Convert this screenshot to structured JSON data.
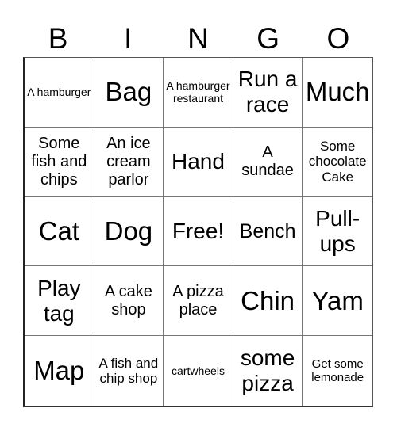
{
  "header": {
    "letters": [
      "B",
      "I",
      "N",
      "G",
      "O"
    ]
  },
  "board": {
    "cells": [
      [
        "A hamburger",
        "Bag",
        "A hamburger restaurant",
        "Run a race",
        "Much"
      ],
      [
        "Some fish and chips",
        "An ice cream parlor",
        "Hand",
        "A sundae",
        "Some chocolate Cake"
      ],
      [
        "Cat",
        "Dog",
        "Free!",
        "Bench",
        "Pull-ups"
      ],
      [
        "Play tag",
        "A cake shop",
        "A pizza place",
        "Chin",
        "Yam"
      ],
      [
        "Map",
        "A fish and chip shop",
        "cartwheels",
        "some pizza",
        "Get some lemonade"
      ]
    ],
    "free_space_label": "Free!"
  }
}
